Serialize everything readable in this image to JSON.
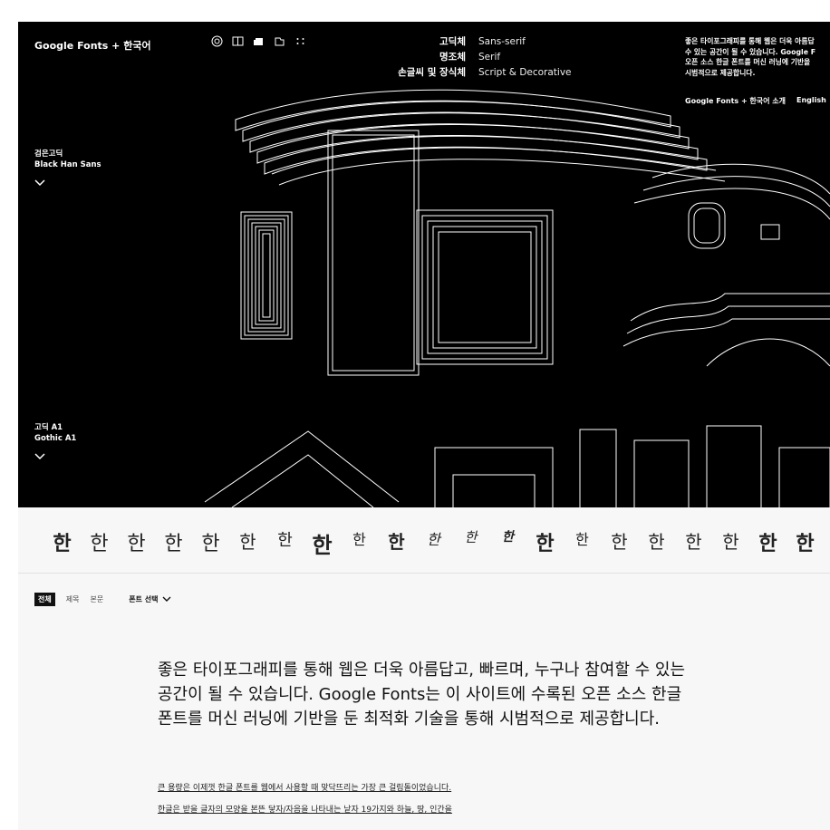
{
  "header": {
    "logo": "Google Fonts + 한국어",
    "categories": [
      {
        "ko": "고딕체",
        "en": "Sans-serif"
      },
      {
        "ko": "명조체",
        "en": "Serif"
      },
      {
        "ko": "손글씨 및 장식체",
        "en": "Script & Decorative"
      }
    ],
    "intro": "좋은 타이포그래피를 통해 웹은 더욱 아름답\n수 있는 공간이 될 수 있습니다. Google F\n오픈 소스 한글 폰트를 머신 러닝에 기반을\n시범적으로 제공합니다.",
    "links": [
      "Google Fonts + 한국어 소개",
      "English"
    ]
  },
  "fonts": [
    {
      "ko": "검은고딕",
      "en": "Black Han Sans"
    },
    {
      "ko": "고딕 A1",
      "en": "Gothic A1"
    }
  ],
  "samples": [
    "한",
    "한",
    "한",
    "한",
    "한",
    "한",
    "한",
    "한",
    "한",
    "한",
    "한",
    "한",
    "한",
    "한",
    "한",
    "한",
    "한",
    "한",
    "한",
    "한",
    "한"
  ],
  "filters": {
    "chips": [
      "전체",
      "제목",
      "본문"
    ],
    "select_label": "폰트 선택"
  },
  "content": {
    "main": "좋은 타이포그래피를 통해 웹은 더욱 아름답고, 빠르며, 누구나 참여할 수 있는 공간이 될 수 있습니다. Google Fonts는 이 사이트에 수록된 오픈 소스 한글 폰트를 머신 러닝에 기반을 둔 최적화 기술을 통해 시범적으로 제공합니다.",
    "sub1": "큰 용량은 이제껏 한글 폰트를 웹에서 사용할 때 맞닥뜨리는 가장 큰 걸림돌이었습니다.",
    "sub2": "한글은 받을 글자의 모양을 본뜬 닿자/자음을 나타내는 낱자 19가지와 하늘, 땅, 인간을"
  }
}
